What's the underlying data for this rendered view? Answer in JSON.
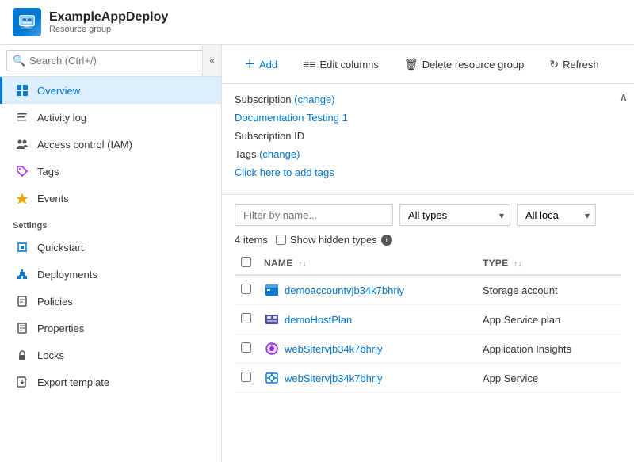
{
  "header": {
    "title": "ExampleAppDeploy",
    "subtitle": "Resource group",
    "icon_label": "resource-group-icon"
  },
  "search": {
    "placeholder": "Search (Ctrl+/)"
  },
  "sidebar": {
    "nav_items": [
      {
        "id": "overview",
        "label": "Overview",
        "icon": "overview",
        "active": true
      },
      {
        "id": "activity-log",
        "label": "Activity log",
        "icon": "activity"
      },
      {
        "id": "access-control",
        "label": "Access control (IAM)",
        "icon": "iam"
      },
      {
        "id": "tags",
        "label": "Tags",
        "icon": "tags"
      },
      {
        "id": "events",
        "label": "Events",
        "icon": "events"
      }
    ],
    "section_label": "Settings",
    "settings_items": [
      {
        "id": "quickstart",
        "label": "Quickstart",
        "icon": "quickstart"
      },
      {
        "id": "deployments",
        "label": "Deployments",
        "icon": "deployments"
      },
      {
        "id": "policies",
        "label": "Policies",
        "icon": "policies"
      },
      {
        "id": "properties",
        "label": "Properties",
        "icon": "properties"
      },
      {
        "id": "locks",
        "label": "Locks",
        "icon": "locks"
      },
      {
        "id": "export-template",
        "label": "Export template",
        "icon": "export"
      }
    ]
  },
  "toolbar": {
    "add_label": "Add",
    "edit_columns_label": "Edit columns",
    "delete_group_label": "Delete resource group",
    "refresh_label": "Refresh"
  },
  "info": {
    "subscription_label": "Subscription",
    "subscription_change": "(change)",
    "subscription_value": "Documentation Testing 1",
    "subscription_id_label": "Subscription ID",
    "tags_label": "Tags",
    "tags_change": "(change)",
    "tags_add": "Click here to add tags"
  },
  "filter": {
    "name_placeholder": "Filter by name...",
    "types_label": "All types",
    "locations_label": "All loca",
    "items_count": "4 items",
    "show_hidden_label": "Show hidden types"
  },
  "table": {
    "headers": [
      "",
      "NAME",
      "TYPE"
    ],
    "rows": [
      {
        "id": "row1",
        "name": "demoaccountvjb34k7bhriy",
        "type": "Storage account",
        "icon_type": "storage"
      },
      {
        "id": "row2",
        "name": "demoHostPlan",
        "type": "App Service plan",
        "icon_type": "appservice-plan"
      },
      {
        "id": "row3",
        "name": "webSitervjb34k7bhriy",
        "type": "Application Insights",
        "icon_type": "insights"
      },
      {
        "id": "row4",
        "name": "webSitervjb34k7bhriy",
        "type": "App Service",
        "icon_type": "appservice"
      }
    ]
  }
}
